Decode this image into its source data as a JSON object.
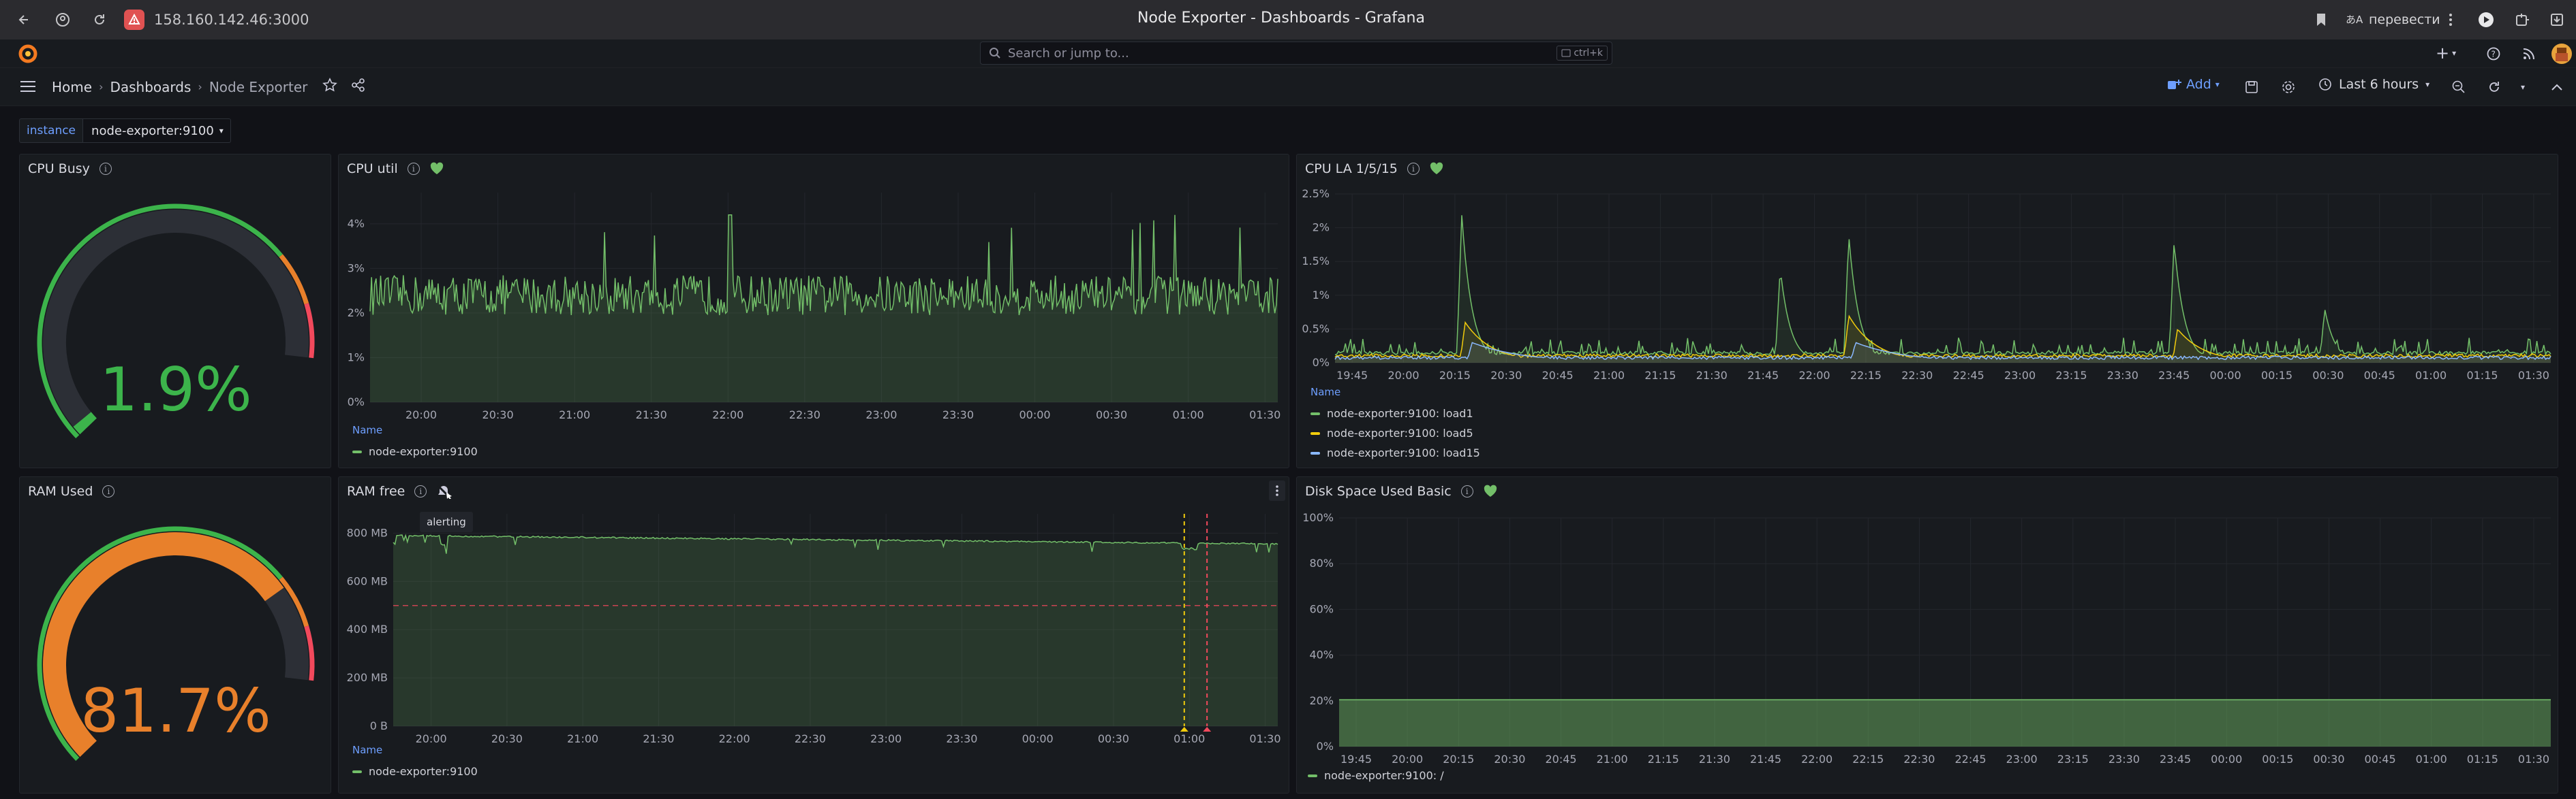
{
  "browser": {
    "url": "158.160.142.46:3000",
    "window_title": "Node Exporter - Dashboards - Grafana",
    "translate_label": "перевести"
  },
  "nav": {
    "search_placeholder": "Search or jump to...",
    "search_shortcut": "ctrl+k"
  },
  "toolbar": {
    "breadcrumbs": [
      "Home",
      "Dashboards",
      "Node Exporter"
    ],
    "add_label": "Add",
    "time_range": "Last 6 hours"
  },
  "variables": {
    "label": "instance",
    "value": "node-exporter:9100"
  },
  "panels": {
    "cpu_busy": {
      "title": "CPU Busy",
      "value": "1.9%",
      "fraction": 0.019,
      "color": "#3cb44b"
    },
    "ram_used": {
      "title": "RAM Used",
      "value": "81.7%",
      "fraction": 0.817,
      "color": "#e8802b"
    },
    "cpu_util": {
      "title": "CPU util",
      "legend_header": "Name",
      "legend": [
        "node-exporter:9100"
      ]
    },
    "cpu_la": {
      "title": "CPU LA 1/5/15",
      "legend_header": "Name",
      "legend": [
        "node-exporter:9100: load1",
        "node-exporter:9100: load5",
        "node-exporter:9100: load15"
      ]
    },
    "ram_free": {
      "title": "RAM free",
      "legend_header": "Name",
      "legend": [
        "node-exporter:9100"
      ],
      "tooltip": "alerting"
    },
    "disk": {
      "title": "Disk Space Used Basic",
      "legend": [
        "node-exporter:9100: /"
      ]
    }
  },
  "colors": {
    "series_green": "#73bf69",
    "series_yellow": "#f2cc0c",
    "series_blue": "#8ab8ff",
    "threshold_red": "#f2495c",
    "accent_blue": "#6e9fff"
  },
  "chart_data": [
    {
      "type": "area",
      "title": "CPU util",
      "x": [
        "20:00",
        "20:30",
        "21:00",
        "21:30",
        "22:00",
        "22:30",
        "23:00",
        "23:30",
        "00:00",
        "00:30",
        "01:00",
        "01:30"
      ],
      "yticks": [
        "0%",
        "1%",
        "2%",
        "3%",
        "4%"
      ],
      "ylim": [
        0,
        4.7
      ],
      "series": [
        {
          "name": "node-exporter:9100",
          "typical": 2.4,
          "min": 1.9,
          "max": 4.2
        }
      ]
    },
    {
      "type": "line",
      "title": "CPU LA 1/5/15",
      "x": [
        "19:45",
        "20:00",
        "20:15",
        "20:30",
        "20:45",
        "21:00",
        "21:15",
        "21:30",
        "21:45",
        "22:00",
        "22:15",
        "22:30",
        "22:45",
        "23:00",
        "23:15",
        "23:30",
        "23:45",
        "00:00",
        "00:15",
        "00:30",
        "00:45",
        "01:00",
        "01:15",
        "01:30"
      ],
      "yticks": [
        "0%",
        "0.5%",
        "1%",
        "1.5%",
        "2%",
        "2.5%"
      ],
      "ylim": [
        0,
        2.5
      ],
      "series": [
        {
          "name": "node-exporter:9100: load1",
          "peaks": [
            [
              "20:17",
              2.2
            ],
            [
              "21:50",
              1.4
            ],
            [
              "22:10",
              1.9
            ],
            [
              "23:45",
              1.8
            ],
            [
              "00:29",
              0.8
            ]
          ]
        },
        {
          "name": "node-exporter:9100: load5",
          "peaks": [
            [
              "20:18",
              0.6
            ],
            [
              "22:10",
              0.7
            ],
            [
              "23:46",
              0.5
            ]
          ]
        },
        {
          "name": "node-exporter:9100: load15",
          "peaks": [
            [
              "20:20",
              0.3
            ],
            [
              "22:12",
              0.3
            ]
          ]
        }
      ]
    },
    {
      "type": "area",
      "title": "RAM free",
      "x": [
        "20:00",
        "20:30",
        "21:00",
        "21:30",
        "22:00",
        "22:30",
        "23:00",
        "23:30",
        "00:00",
        "00:30",
        "01:00",
        "01:30"
      ],
      "yticks": [
        "0 B",
        "200 MB",
        "400 MB",
        "600 MB",
        "800 MB"
      ],
      "ylim": [
        0,
        880
      ],
      "threshold": 500,
      "series": [
        {
          "name": "node-exporter:9100",
          "start": 790,
          "end": 755
        }
      ]
    },
    {
      "type": "area",
      "title": "Disk Space Used Basic",
      "x": [
        "19:45",
        "20:00",
        "20:15",
        "20:30",
        "20:45",
        "21:00",
        "21:15",
        "21:30",
        "21:45",
        "22:00",
        "22:15",
        "22:30",
        "22:45",
        "23:00",
        "23:15",
        "23:30",
        "23:45",
        "00:00",
        "00:15",
        "00:30",
        "00:45",
        "01:00",
        "01:15",
        "01:30"
      ],
      "yticks": [
        "0%",
        "20%",
        "40%",
        "60%",
        "80%",
        "100%"
      ],
      "ylim": [
        0,
        100
      ],
      "series": [
        {
          "name": "node-exporter:9100: /",
          "value": 20.5
        }
      ]
    }
  ]
}
